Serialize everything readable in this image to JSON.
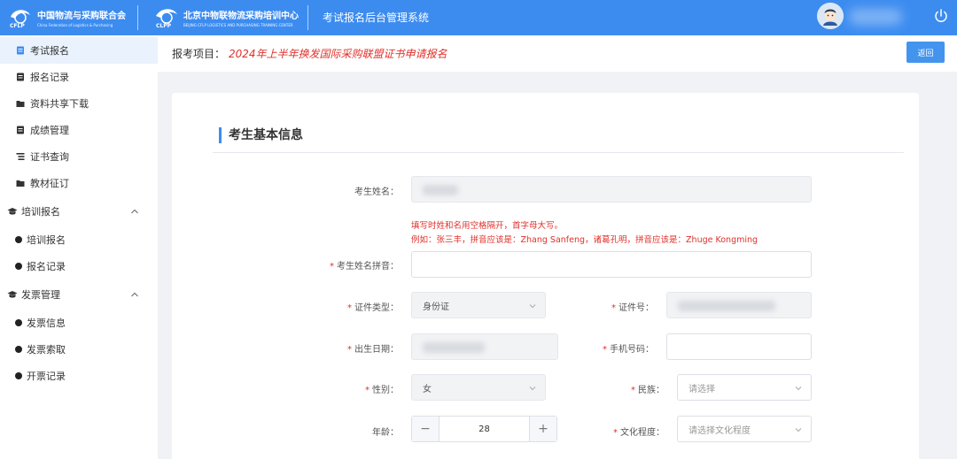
{
  "header": {
    "logo1_cn": "中国物流与采购联合会",
    "logo1_en": "China Federation of Logistics & Purchasing",
    "logo1_mark": "CFLP",
    "logo2_cn": "北京中物联物流采购培训中心",
    "logo2_en": "BEIJING CFLP LOGISTICS AND PURCHASING TRAINING CENTER",
    "logo2_mark": "CLPP",
    "system_title": "考试报名后台管理系统",
    "icons": [
      "avatar",
      "power-icon"
    ]
  },
  "sidebar": {
    "items": [
      {
        "label": "考试报名",
        "icon": "document-icon",
        "active": true
      },
      {
        "label": "报名记录",
        "icon": "document-icon"
      },
      {
        "label": "资料共享下载",
        "icon": "folder-icon"
      },
      {
        "label": "成绩管理",
        "icon": "document-icon"
      },
      {
        "label": "证书查询",
        "icon": "list-icon"
      },
      {
        "label": "教材征订",
        "icon": "folder-icon"
      }
    ],
    "groups": [
      {
        "label": "培训报名",
        "icon": "graduation-cap-icon",
        "expanded": true,
        "children": [
          "培训报名",
          "报名记录"
        ]
      },
      {
        "label": "发票管理",
        "icon": "graduation-cap-icon",
        "expanded": true,
        "children": [
          "发票信息",
          "发票索取",
          "开票记录"
        ]
      }
    ]
  },
  "topbar": {
    "label": "报考项目：",
    "project": "2024年上半年换发国际采购联盟证书申请报名",
    "back_button": "返回"
  },
  "form": {
    "section_title": "考生基本信息",
    "name_label": "考生姓名：",
    "hint_line1": "填写时姓和名用空格隔开，首字母大写。",
    "hint_line2": "例如：张三丰，拼音应该是：Zhang Sanfeng，诸葛孔明，拼音应该是：Zhuge Kongming",
    "pinyin_label": "考生姓名拼音：",
    "id_type_label": "证件类型：",
    "id_type_value": "身份证",
    "id_no_label": "证件号：",
    "birth_label": "出生日期：",
    "phone_label": "手机号码：",
    "gender_label": "性别：",
    "gender_value": "女",
    "ethnic_label": "民族：",
    "ethnic_placeholder": "请选择",
    "age_label": "年龄：",
    "age_value": "28",
    "edu_label": "文化程度：",
    "edu_placeholder": "请选择文化程度"
  },
  "colors": {
    "primary": "#3c8cf0",
    "required": "#e0302a",
    "back_button": "#4394ee"
  }
}
